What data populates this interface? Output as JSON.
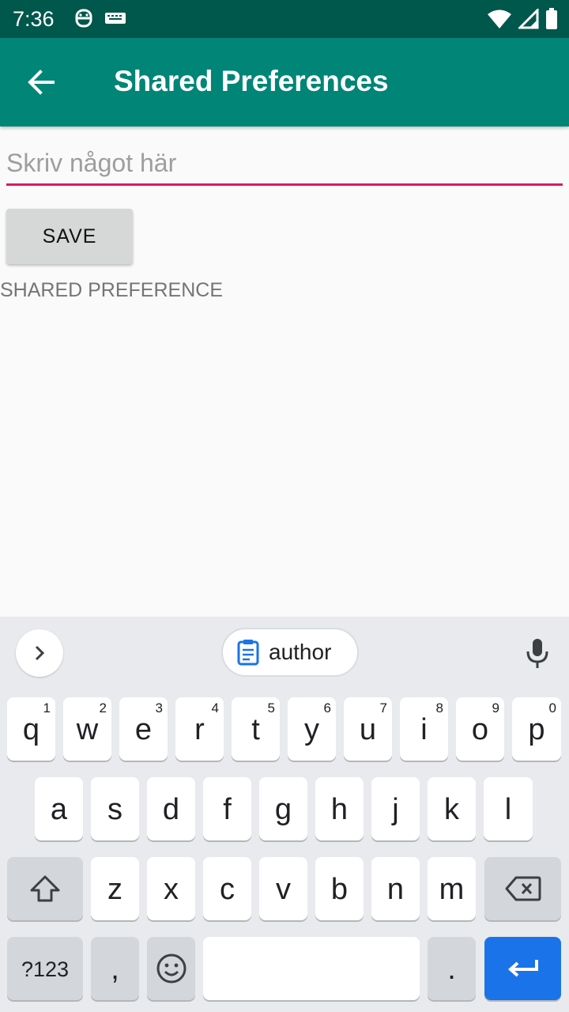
{
  "status_bar": {
    "time": "7:36",
    "icons": [
      "robot-icon",
      "keyboard-icon",
      "wifi-icon",
      "signal-icon",
      "battery-icon"
    ]
  },
  "app_bar": {
    "title": "Shared Preferences",
    "back_icon": "arrow-back-icon",
    "color": "#008577"
  },
  "form": {
    "input_placeholder": "Skriv något här",
    "input_value": "",
    "save_label": "SAVE",
    "preference_text": "SHARED PREFERENCE",
    "accent_color": "#d81b60"
  },
  "keyboard": {
    "suggestion_chip": "author",
    "row1": [
      {
        "label": "q",
        "hint": "1"
      },
      {
        "label": "w",
        "hint": "2"
      },
      {
        "label": "e",
        "hint": "3"
      },
      {
        "label": "r",
        "hint": "4"
      },
      {
        "label": "t",
        "hint": "5"
      },
      {
        "label": "y",
        "hint": "6"
      },
      {
        "label": "u",
        "hint": "7"
      },
      {
        "label": "i",
        "hint": "8"
      },
      {
        "label": "o",
        "hint": "9"
      },
      {
        "label": "p",
        "hint": "0"
      }
    ],
    "row2": [
      "a",
      "s",
      "d",
      "f",
      "g",
      "h",
      "j",
      "k",
      "l"
    ],
    "row3": [
      "z",
      "x",
      "c",
      "v",
      "b",
      "n",
      "m"
    ],
    "symbols_label": "?123",
    "comma_label": ",",
    "period_label": ".",
    "enter_color": "#1a73e8"
  }
}
